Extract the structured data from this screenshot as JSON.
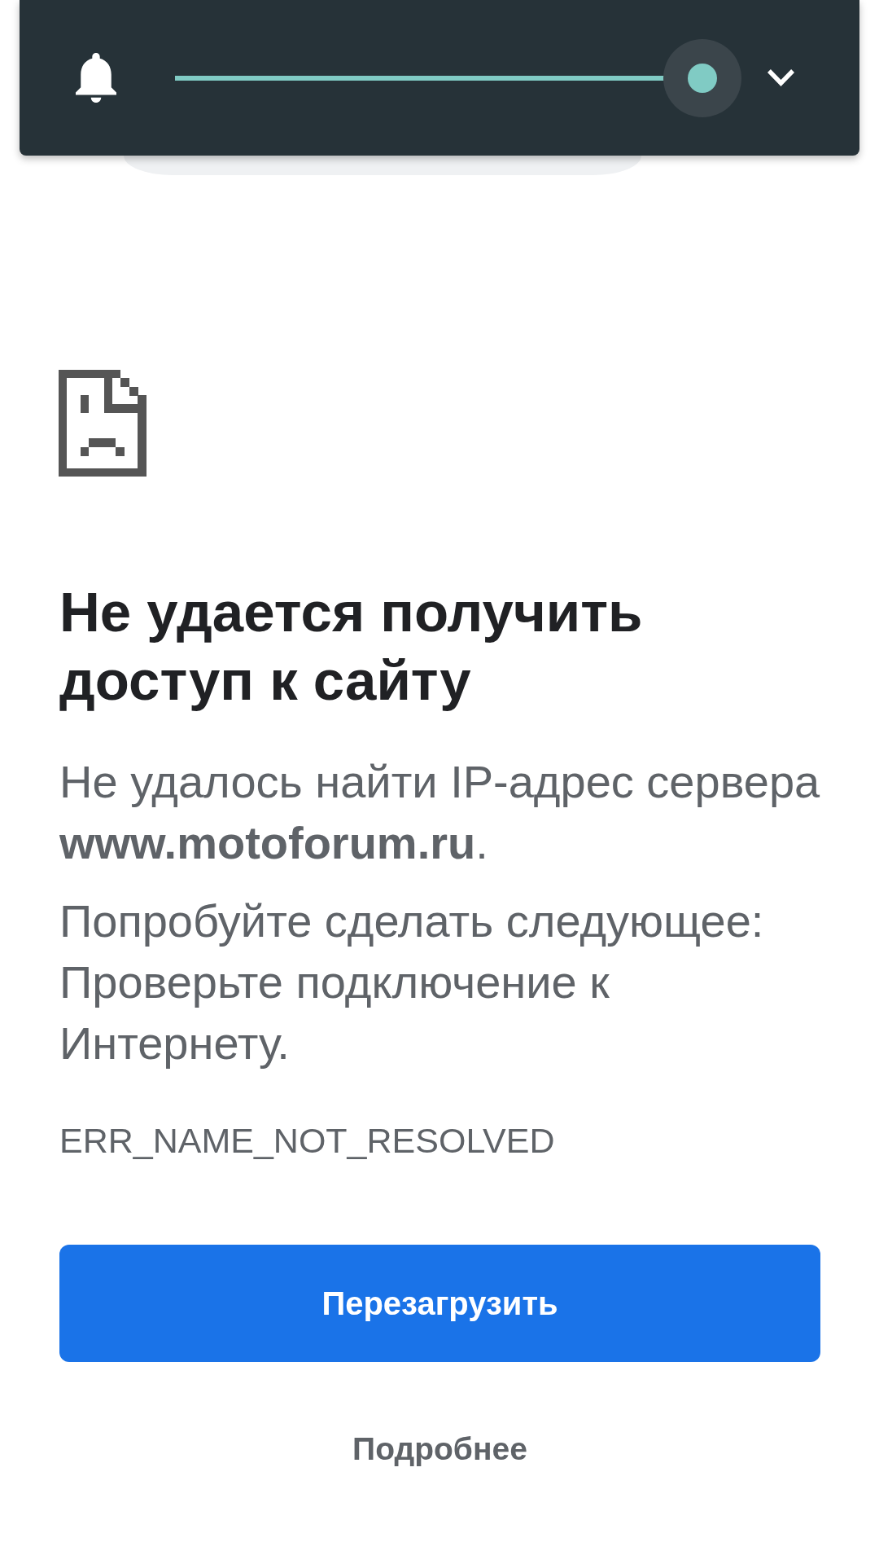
{
  "volume_panel": {
    "slider": {
      "level": 1
    }
  },
  "error_page": {
    "heading": "Не удается получить доступ к сайту",
    "message": "Не удалось найти IP-адрес сервера **www.motoforum.ru**.",
    "suggestions_heading": "Попробуйте сделать следующее:",
    "suggestions": [
      "Проверьте подключение к Интернету."
    ],
    "error_code": "ERR_NAME_NOT_RESOLVED",
    "reload_button": "Перезагрузить",
    "details_button": "Подробнее"
  }
}
